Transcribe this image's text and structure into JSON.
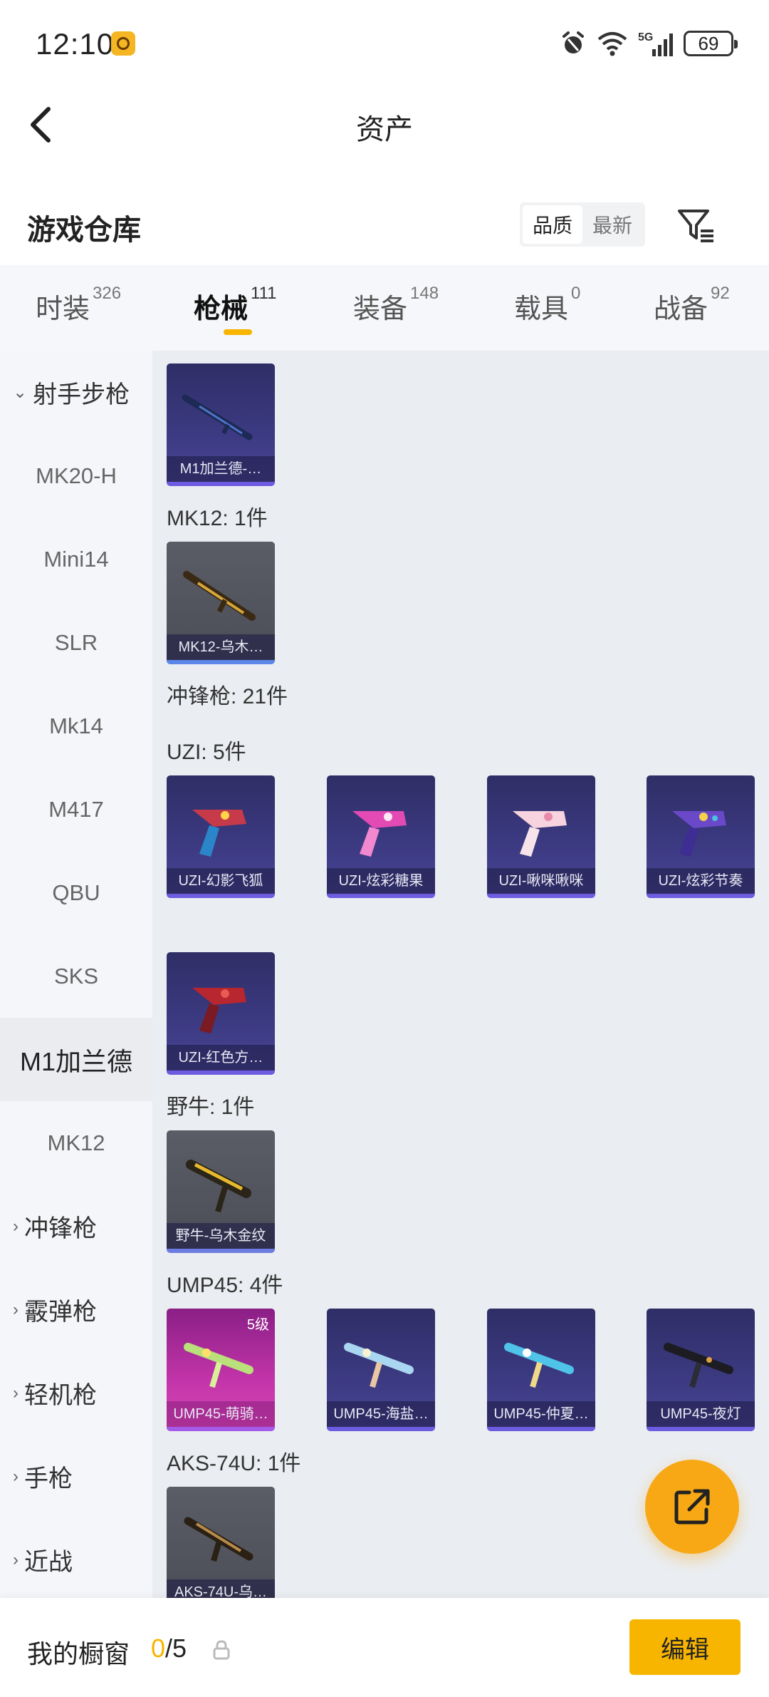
{
  "status_bar": {
    "time": "12:10",
    "battery": "69",
    "network": "5G"
  },
  "header": {
    "title": "资产"
  },
  "warehouse": {
    "title": "游戏仓库",
    "sort_options": [
      "品质",
      "最新"
    ],
    "active_sort": "品质"
  },
  "tabs": [
    {
      "label": "时装",
      "count": "326"
    },
    {
      "label": "枪械",
      "count": "111"
    },
    {
      "label": "装备",
      "count": "148"
    },
    {
      "label": "载具",
      "count": "0"
    },
    {
      "label": "战备",
      "count": "92"
    }
  ],
  "active_tab": "枪械",
  "sidebar": {
    "items": [
      {
        "label": "射手步枪",
        "chev": "⌄"
      },
      {
        "label": "MK20-H"
      },
      {
        "label": "Mini14"
      },
      {
        "label": "SLR"
      },
      {
        "label": "Mk14"
      },
      {
        "label": "M417"
      },
      {
        "label": "QBU"
      },
      {
        "label": "SKS"
      },
      {
        "label": "M1加兰德"
      },
      {
        "label": "MK12"
      },
      {
        "label": "冲锋枪",
        "chev": "›"
      },
      {
        "label": "霰弹枪",
        "chev": "›"
      },
      {
        "label": "轻机枪",
        "chev": "›"
      },
      {
        "label": "手枪",
        "chev": "›"
      },
      {
        "label": "近战",
        "chev": "›"
      }
    ],
    "selected": "M1加兰德"
  },
  "content": {
    "sections": [
      {
        "label": "MK12: 1件"
      },
      {
        "label": "冲锋枪: 21件"
      },
      {
        "label": "UZI: 5件"
      },
      {
        "label": "野牛: 1件"
      },
      {
        "label": "UMP45: 4件"
      },
      {
        "label": "AKS-74U: 1件"
      }
    ],
    "cards": [
      {
        "name": "M1加兰德-…"
      },
      {
        "name": "MK12-乌木…"
      },
      {
        "name": "UZI-幻影飞狐"
      },
      {
        "name": "UZI-炫彩糖果"
      },
      {
        "name": "UZI-啾咪啾咪"
      },
      {
        "name": "UZI-炫彩节奏"
      },
      {
        "name": "UZI-红色方…"
      },
      {
        "name": "野牛-乌木金纹"
      },
      {
        "name": "UMP45-萌骑…",
        "level": "5级"
      },
      {
        "name": "UMP45-海盐…"
      },
      {
        "name": "UMP45-仲夏…"
      },
      {
        "name": "UMP45-夜灯"
      },
      {
        "name": "AKS-74U-乌…"
      }
    ]
  },
  "bottom_bar": {
    "label": "我的橱窗",
    "current": "0",
    "total": "/5",
    "edit_label": "编辑"
  },
  "colors": {
    "accent": "#f7b500",
    "fab": "#f7a814",
    "card_purple": "#3c3a82",
    "card_pink": "#c234a9"
  }
}
